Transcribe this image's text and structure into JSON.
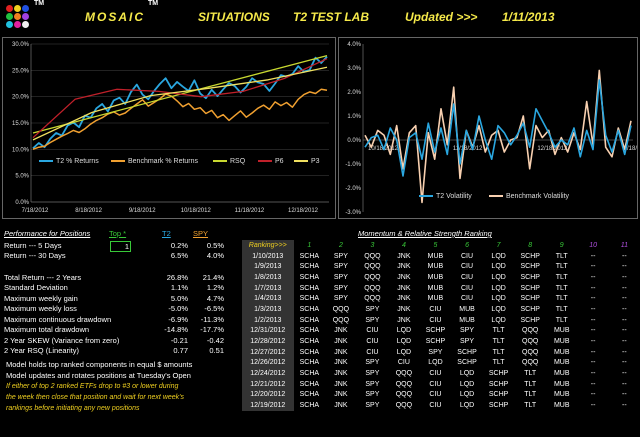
{
  "header": {
    "brand": "MOSAIC",
    "tm": "TM",
    "situations": "SITUATIONS",
    "lab": "T2 TEST LAB",
    "updated": "Updated >>>",
    "date": "1/11/2013"
  },
  "colors": {
    "title": "#f5e94a",
    "t2": "#2aa7e0",
    "bench": "#f0a030",
    "rsq": "#c8d830",
    "p6": "#c0202a",
    "p3": "#f0e060",
    "green": "#38c838",
    "purple": "#b050e0"
  },
  "chart_data": [
    {
      "type": "line",
      "title": "",
      "ylim": [
        0,
        30
      ],
      "yticks": [
        "0.0%",
        "5.0%",
        "10.0%",
        "15.0%",
        "20.0%",
        "25.0%",
        "30.0%"
      ],
      "xticks": [
        "7/18/2012",
        "8/18/2012",
        "9/18/2012",
        "10/18/2012",
        "11/18/2012",
        "12/18/2012"
      ],
      "series": [
        {
          "name": "T2 % Returns",
          "values": [
            10.2,
            11.2,
            10.4,
            12.0,
            13.1,
            12.6,
            14.5,
            15.1,
            14.2,
            16.4,
            16.0,
            17.8,
            18.6,
            17.2,
            19.3,
            19.8,
            18.6,
            20.9,
            22.3,
            20.4,
            19.5,
            21.1,
            22.4,
            23.5,
            21.6,
            22.8,
            21.9,
            21.1,
            23.1,
            20.6,
            19.7,
            21.3,
            20.1,
            21.4,
            22.6,
            22.0,
            20.8,
            21.9,
            23.5,
            22.7,
            22.4,
            21.1,
            22.5,
            24.1,
            23.8,
            24.3,
            25.8,
            24.7,
            25.1,
            27.4,
            26.4,
            27.6
          ]
        },
        {
          "name": "Benchmark % Returns",
          "values": [
            10.0,
            10.4,
            10.6,
            11.3,
            11.9,
            12.5,
            13.0,
            13.6,
            13.2,
            13.9,
            14.8,
            15.5,
            16.0,
            16.7,
            17.1,
            16.5,
            16.9,
            17.8,
            18.6,
            19.4,
            18.2,
            18.9,
            19.6,
            20.5,
            20.1,
            19.2,
            18.1,
            18.7,
            17.6,
            17.9,
            16.8,
            17.4,
            16.0,
            16.6,
            15.5,
            16.4,
            17.3,
            16.1,
            16.9,
            17.8,
            18.4,
            17.6,
            19.0,
            18.3,
            18.9,
            18.0,
            19.5,
            20.4,
            20.9,
            20.6,
            21.4,
            21.2
          ]
        },
        {
          "name": "RSQ",
          "values": [
            13.1,
            27.8
          ]
        },
        {
          "name": "P6",
          "values": [
            12.2,
            19.5,
            21.4,
            21.0,
            20.0,
            21.0,
            23.5,
            27.2
          ]
        },
        {
          "name": "P3",
          "values": [
            11.8,
            17.0,
            20.2,
            21.6,
            23.2,
            25.6
          ]
        }
      ]
    },
    {
      "type": "line",
      "title": "",
      "ylim": [
        -3,
        4
      ],
      "yticks": [
        "-3.0%",
        "-2.0%",
        "-1.0%",
        "0.0%",
        "1.0%",
        "2.0%",
        "3.0%",
        "4.0%"
      ],
      "xticks": [
        "10/18/2012",
        "11/18/2012",
        "12/18/2012",
        "1/18/2013"
      ],
      "series": [
        {
          "name": "T2 Volatility",
          "values": [
            -0.3,
            0.1,
            0.2,
            -0.4,
            0.5,
            0.0,
            -1.5,
            0.1,
            0.3,
            -0.8,
            0.7,
            -0.5,
            0.5,
            -0.6,
            1.5,
            -1.0,
            0.4,
            -0.4,
            1.0,
            0.0,
            -0.8,
            0.6,
            0.3,
            -0.2,
            0.2,
            0.7,
            -0.3,
            1.3,
            0.8,
            0.3,
            -0.3,
            0.0,
            -0.2,
            0.5,
            -0.7,
            0.4,
            -0.4,
            2.5,
            0.2,
            -0.5,
            0.4,
            -0.6,
            0.6
          ]
        },
        {
          "name": "Benchmark Volatility",
          "values": [
            0.2,
            -0.3,
            0.4,
            0.2,
            -0.6,
            0.6,
            -1.2,
            0.3,
            0.6,
            -2.6,
            0.3,
            -0.8,
            1.3,
            -0.2,
            2.2,
            -1.6,
            0.4,
            -0.3,
            0.6,
            -0.5,
            0.2,
            0.4,
            -0.5,
            0.0,
            0.1,
            1.0,
            -1.2,
            0.6,
            0.1,
            0.4,
            -0.6,
            0.1,
            -0.5,
            0.3,
            -0.4,
            1.6,
            -0.2,
            2.9,
            -0.3,
            -0.7,
            0.5,
            -0.4,
            0.8
          ]
        }
      ]
    }
  ],
  "perf": {
    "heading": "Performance for Positions",
    "top_label": "Top *",
    "top_value": "1",
    "cols": [
      "T2",
      "SPY"
    ],
    "rows5": [
      [
        "Return --- 5 Days",
        "0.2%",
        "0.5%"
      ],
      [
        "Return --- 30 Days",
        "6.5%",
        "4.0%"
      ]
    ],
    "rows": [
      [
        "Total Return --- 2 Years",
        "26.8%",
        "21.4%"
      ],
      [
        "Standard Deviation",
        "1.1%",
        "1.2%"
      ],
      [
        "Maximum weekly gain",
        "5.0%",
        "4.7%"
      ],
      [
        "Maximum weekly loss",
        "-5.0%",
        "-6.5%"
      ],
      [
        "Maximum continuous drawdown",
        "-6.9%",
        "-11.3%"
      ],
      [
        "Maximum total drawdown",
        "-14.8%",
        "-17.7%"
      ],
      [
        "2 Year SKEW  (Variance from zero)",
        "-0.21",
        "-0.42"
      ],
      [
        "2 Year RSQ  (Linearity)",
        "0.77",
        "0.51"
      ]
    ]
  },
  "notes": {
    "l1": "Model holds top ranked  components in equal  $ amounts",
    "l2": "Model updates and rotates positions at Tuesday's Open",
    "l3": "If either of top 2 ranked ETFs drop to #3 or lower during",
    "l4": "the week then close that position and wait for next week's",
    "l5": "rankings before initiating any new positions"
  },
  "ranking": {
    "heading": "Momentum & Relative Strength Ranking",
    "label": "Ranking>>>",
    "cols": [
      "1",
      "2",
      "3",
      "4",
      "5",
      "6",
      "7",
      "8",
      "9",
      "10",
      "11"
    ],
    "rows": [
      [
        "1/10/2013",
        "SCHA",
        "SPY",
        "QQQ",
        "JNK",
        "MUB",
        "CIU",
        "LQD",
        "SCHP",
        "TLT",
        "--",
        "--"
      ],
      [
        "1/9/2013",
        "SCHA",
        "SPY",
        "QQQ",
        "JNK",
        "MUB",
        "CIU",
        "LQD",
        "SCHP",
        "TLT",
        "--",
        "--"
      ],
      [
        "1/8/2013",
        "SCHA",
        "SPY",
        "QQQ",
        "JNK",
        "MUB",
        "CIU",
        "LQD",
        "SCHP",
        "TLT",
        "--",
        "--"
      ],
      [
        "1/7/2013",
        "SCHA",
        "SPY",
        "QQQ",
        "JNK",
        "MUB",
        "CIU",
        "LQD",
        "SCHP",
        "TLT",
        "--",
        "--"
      ],
      [
        "1/4/2013",
        "SCHA",
        "SPY",
        "QQQ",
        "JNK",
        "MUB",
        "CIU",
        "LQD",
        "SCHP",
        "TLT",
        "--",
        "--"
      ],
      [
        "1/3/2013",
        "SCHA",
        "QQQ",
        "SPY",
        "JNK",
        "CIU",
        "MUB",
        "LQD",
        "SCHP",
        "TLT",
        "--",
        "--"
      ],
      [
        "1/2/2013",
        "SCHA",
        "QQQ",
        "SPY",
        "JNK",
        "CIU",
        "MUB",
        "LQD",
        "SCHP",
        "TLT",
        "--",
        "--"
      ],
      [
        "12/31/2012",
        "SCHA",
        "JNK",
        "CIU",
        "LQD",
        "SCHP",
        "SPY",
        "TLT",
        "QQQ",
        "MUB",
        "--",
        "--"
      ],
      [
        "12/28/2012",
        "SCHA",
        "JNK",
        "CIU",
        "LQD",
        "SCHP",
        "SPY",
        "TLT",
        "QQQ",
        "MUB",
        "--",
        "--"
      ],
      [
        "12/27/2012",
        "SCHA",
        "JNK",
        "CIU",
        "LQD",
        "SPY",
        "SCHP",
        "TLT",
        "QQQ",
        "MUB",
        "--",
        "--"
      ],
      [
        "12/26/2012",
        "SCHA",
        "JNK",
        "SPY",
        "CIU",
        "LQD",
        "SCHP",
        "TLT",
        "QQQ",
        "MUB",
        "--",
        "--"
      ],
      [
        "12/24/2012",
        "SCHA",
        "JNK",
        "SPY",
        "QQQ",
        "CIU",
        "LQD",
        "SCHP",
        "TLT",
        "MUB",
        "--",
        "--"
      ],
      [
        "12/21/2012",
        "SCHA",
        "JNK",
        "SPY",
        "QQQ",
        "CIU",
        "LQD",
        "SCHP",
        "TLT",
        "MUB",
        "--",
        "--"
      ],
      [
        "12/20/2012",
        "SCHA",
        "JNK",
        "SPY",
        "QQQ",
        "CIU",
        "LQD",
        "SCHP",
        "TLT",
        "MUB",
        "--",
        "--"
      ],
      [
        "12/19/2012",
        "SCHA",
        "JNK",
        "SPY",
        "QQQ",
        "CIU",
        "LQD",
        "SCHP",
        "TLT",
        "MUB",
        "--",
        "--"
      ]
    ]
  }
}
